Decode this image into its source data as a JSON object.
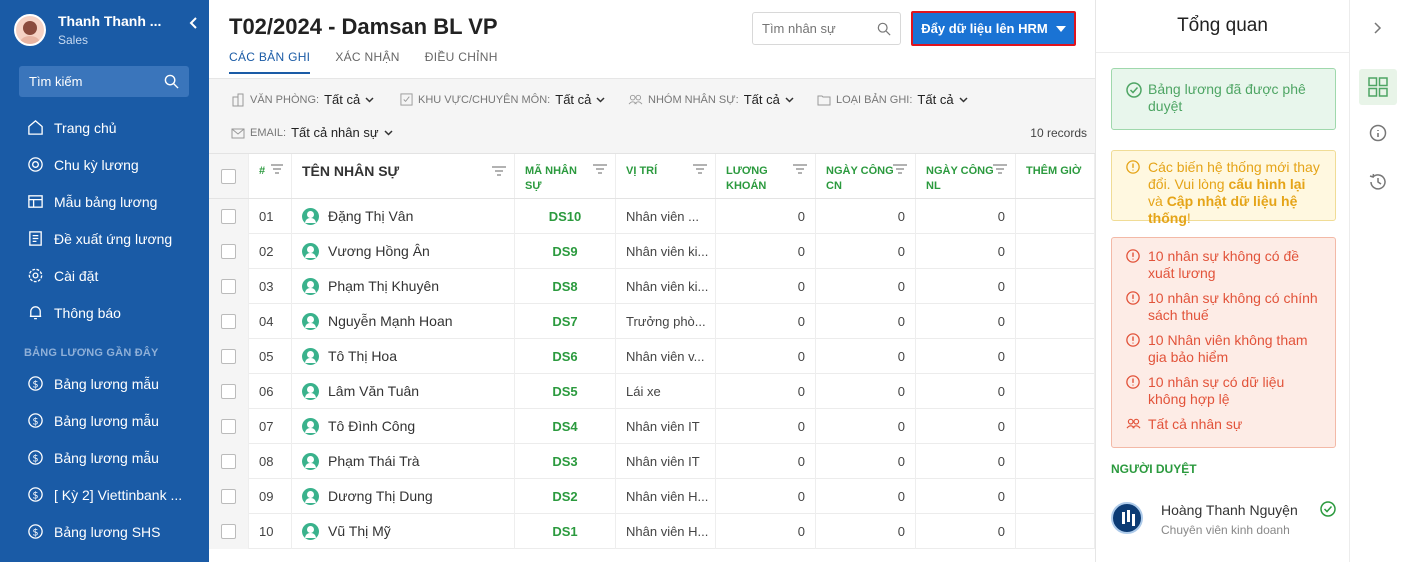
{
  "user": {
    "name": "Thanh Thanh ...",
    "role": "Sales"
  },
  "sidebar": {
    "search_label": "Tìm kiếm",
    "items": [
      {
        "label": "Trang chủ",
        "icon": "home-icon"
      },
      {
        "label": "Chu kỳ lương",
        "icon": "cycle-icon"
      },
      {
        "label": "Mẫu bảng lương",
        "icon": "template-icon"
      },
      {
        "label": "Đề xuất ứng lương",
        "icon": "proposal-icon"
      },
      {
        "label": "Cài đặt",
        "icon": "gear-icon"
      },
      {
        "label": "Thông báo",
        "icon": "bell-icon"
      }
    ],
    "recent_title": "BẢNG LƯƠNG GẦN ĐÂY",
    "recent": [
      {
        "label": "Bảng lương mẫu"
      },
      {
        "label": "Bảng lương mẫu"
      },
      {
        "label": "Bảng lương mẫu"
      },
      {
        "label": "[ Kỳ 2] Viettinbank ..."
      },
      {
        "label": "Bảng lương SHS"
      }
    ]
  },
  "header": {
    "title": "T02/2024 - Damsan BL VP",
    "tabs": [
      {
        "label": "CÁC BẢN GHI",
        "active": true
      },
      {
        "label": "XÁC NHẬN",
        "active": false
      },
      {
        "label": "ĐIỀU CHỈNH",
        "active": false
      }
    ],
    "search_placeholder": "Tìm nhân sự",
    "push_button": "Đẩy dữ liệu lên HRM"
  },
  "filters": {
    "office_label": "VĂN PHÒNG:",
    "office_value": "Tất cả",
    "area_label": "KHU VỰC/CHUYÊN MÔN:",
    "area_value": "Tất cả",
    "group_label": "NHÓM NHÂN SỰ:",
    "group_value": "Tất cả",
    "record_label": "LOẠI BẢN GHI:",
    "record_value": "Tất cả",
    "email_label": "EMAIL:",
    "email_value": "Tất cả nhân sự",
    "records_count": "10 records"
  },
  "table": {
    "headers": {
      "num": "#",
      "name": "TÊN NHÂN SỰ",
      "code": "MÃ NHÂN SỰ",
      "position": "VỊ TRÍ",
      "salary": "LƯƠNG KHOÁN",
      "day_cn": "NGÀY CÔNG CN",
      "day_nl": "NGÀY CÔNG NL",
      "overtime": "THÊM GIỜ"
    },
    "rows": [
      {
        "num": "01",
        "name": "Đặng Thị Vân",
        "code": "DS10",
        "position": "Nhân viên ...",
        "salary": "0",
        "cn": "0",
        "nl": "0"
      },
      {
        "num": "02",
        "name": "Vương Hồng Ân",
        "code": "DS9",
        "position": "Nhân viên ki...",
        "salary": "0",
        "cn": "0",
        "nl": "0"
      },
      {
        "num": "03",
        "name": "Phạm Thị Khuyên",
        "code": "DS8",
        "position": "Nhân viên ki...",
        "salary": "0",
        "cn": "0",
        "nl": "0"
      },
      {
        "num": "04",
        "name": "Nguyễn Mạnh Hoan",
        "code": "DS7",
        "position": "Trưởng phò...",
        "salary": "0",
        "cn": "0",
        "nl": "0"
      },
      {
        "num": "05",
        "name": "Tô Thị Hoa",
        "code": "DS6",
        "position": "Nhân viên v...",
        "salary": "0",
        "cn": "0",
        "nl": "0"
      },
      {
        "num": "06",
        "name": "Lâm Văn Tuân",
        "code": "DS5",
        "position": "Lái xe",
        "salary": "0",
        "cn": "0",
        "nl": "0"
      },
      {
        "num": "07",
        "name": "Tô Đình Công",
        "code": "DS4",
        "position": "Nhân viên IT",
        "salary": "0",
        "cn": "0",
        "nl": "0"
      },
      {
        "num": "08",
        "name": "Phạm Thái Trà",
        "code": "DS3",
        "position": "Nhân viên IT",
        "salary": "0",
        "cn": "0",
        "nl": "0"
      },
      {
        "num": "09",
        "name": "Dương Thị Dung",
        "code": "DS2",
        "position": "Nhân viên H...",
        "salary": "0",
        "cn": "0",
        "nl": "0"
      },
      {
        "num": "10",
        "name": "Vũ Thị Mỹ",
        "code": "DS1",
        "position": "Nhân viên H...",
        "salary": "0",
        "cn": "0",
        "nl": "0"
      }
    ]
  },
  "panel": {
    "title": "Tổng quan",
    "approved": "Bảng lương đã được phê duyệt",
    "warn_pre": "Các biến hệ thống mới thay đổi. Vui lòng ",
    "warn_link1": "cấu hình lại",
    "warn_mid": " và ",
    "warn_link2": "Cập nhật dữ liệu hệ thống",
    "warn_post": "!",
    "errors": [
      "10 nhân sự không có đề xuất lương",
      "10 nhân sự không có chính sách thuế",
      "10 Nhân viên không tham gia bảo hiểm",
      "10 nhân sự có dữ liệu không hợp lệ"
    ],
    "all_staff": "Tất cả nhân sự",
    "approver_label": "NGƯỜI DUYỆT",
    "approver_name": "Hoàng Thanh Nguyện",
    "approver_role": "Chuyên viên kinh doanh"
  },
  "colors": {
    "sidebar": "#1a5ba6",
    "accent_green": "#2b9a3e",
    "button_blue": "#1a73d4",
    "highlight_red": "#e0141e"
  }
}
